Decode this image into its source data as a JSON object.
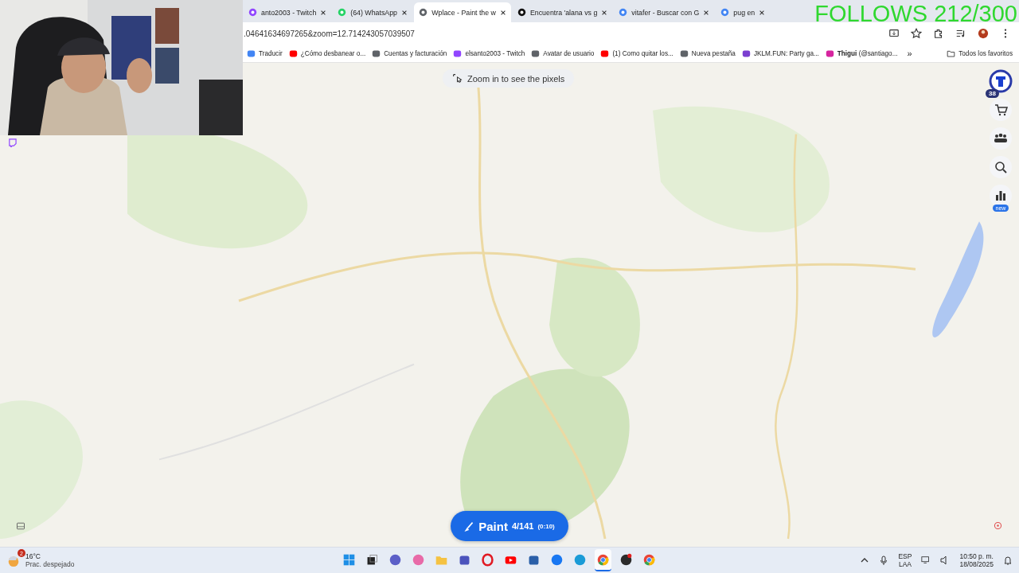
{
  "overlay_text": "FOLLOWS 212/300",
  "tabs": [
    {
      "title": "anto2003 - Twitch",
      "kind": "twitch",
      "selected": false
    },
    {
      "title": "(64) WhatsApp",
      "kind": "whatsapp",
      "selected": false
    },
    {
      "title": "Wplace - Paint the w",
      "kind": "globe",
      "selected": true
    },
    {
      "title": "Encuentra 'alana vs g",
      "kind": "tiktok",
      "selected": false
    },
    {
      "title": "vitafer - Buscar con G",
      "kind": "google",
      "selected": false
    },
    {
      "title": "pug en",
      "kind": "google",
      "selected": false
    }
  ],
  "address": ".04641634697265&zoom=12.714243057039507",
  "bookmarks": [
    {
      "label": "Traducir",
      "kind": "translate"
    },
    {
      "label": "¿Cómo desbanear o...",
      "kind": "youtube"
    },
    {
      "label": "Cuentas y facturación",
      "kind": "globe"
    },
    {
      "label": "elsanto2003 - Twitch",
      "kind": "twitch"
    },
    {
      "label": "Avatar de usuario",
      "kind": "globe"
    },
    {
      "label": "(1) Como quitar los...",
      "kind": "youtube"
    },
    {
      "label": "Nueva pestaña",
      "kind": "globe"
    },
    {
      "label": "JKLM.FUN: Party ga...",
      "kind": "jklm"
    },
    {
      "label": "**Thigui** (@santiago...",
      "kind": "instagram"
    }
  ],
  "bookmarks_more": "»",
  "all_bookmarks": "Todos los favoritos",
  "zoom_hint": "Zoom in to see the pixels",
  "level_badge": "38",
  "new_badge": "new",
  "paint": {
    "label": "Paint",
    "count": "4/141",
    "timer": "(0:10)"
  },
  "taskbar": {
    "weather": {
      "badge": "2",
      "temp": "16°C",
      "text": "Prac. despejado"
    },
    "apps": [
      {
        "kind": "start",
        "selected": false
      },
      {
        "kind": "taskview",
        "selected": false
      },
      {
        "kind": "chat",
        "selected": false
      },
      {
        "kind": "copilot",
        "selected": false
      },
      {
        "kind": "folder",
        "selected": false
      },
      {
        "kind": "teams",
        "selected": false
      },
      {
        "kind": "opera",
        "selected": false
      },
      {
        "kind": "youtube",
        "selected": false
      },
      {
        "kind": "store",
        "selected": false
      },
      {
        "kind": "facebook",
        "selected": false
      },
      {
        "kind": "edge",
        "selected": false
      },
      {
        "kind": "chrome",
        "selected": true
      },
      {
        "kind": "obs",
        "selected": false
      },
      {
        "kind": "chrome",
        "selected": false
      }
    ],
    "language": "ESP",
    "layout": "LAA",
    "time": "10:50 p. m.",
    "date": "18/08/2025"
  }
}
